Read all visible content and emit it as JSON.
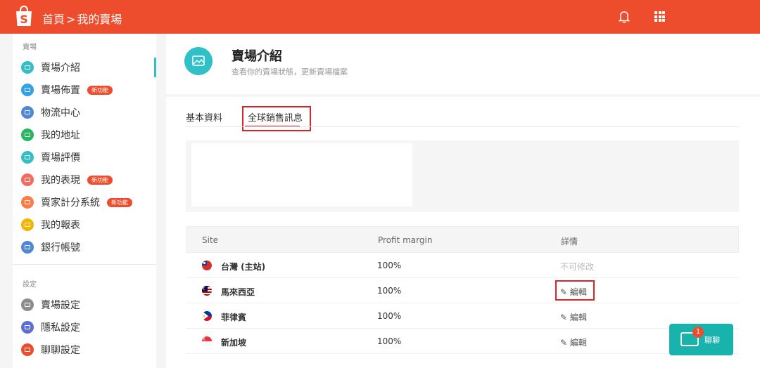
{
  "topbar": {
    "breadcrumb_home": "首頁",
    "breadcrumb_sep": ">",
    "breadcrumb_current": "我的賣場",
    "brand_color": "#ee4d2d"
  },
  "sidebar": {
    "section_shop": "賣場",
    "section_settings": "設定",
    "new_badge": "新功能",
    "shop_items": [
      {
        "label": "賣場介紹",
        "icon": "shop-intro-icon",
        "color": "#31c0c8"
      },
      {
        "label": "賣場佈置",
        "icon": "decoration-icon",
        "color": "#31a2e8"
      },
      {
        "label": "物流中心",
        "icon": "logistics-icon",
        "color": "#4f88d8"
      },
      {
        "label": "我的地址",
        "icon": "address-icon",
        "color": "#25b85f"
      },
      {
        "label": "賣場評價",
        "icon": "rating-icon",
        "color": "#31c0c8"
      },
      {
        "label": "我的表現",
        "icon": "performance-icon",
        "color": "#f56b5c"
      },
      {
        "label": "賣家計分系統",
        "icon": "score-icon",
        "color": "#ff7a45"
      },
      {
        "label": "我的報表",
        "icon": "report-icon",
        "color": "#f5b400"
      },
      {
        "label": "銀行帳號",
        "icon": "bank-icon",
        "color": "#4f88d8"
      }
    ],
    "settings_items": [
      {
        "label": "賣場設定",
        "icon": "shop-settings-icon",
        "color": "#8c8c8c"
      },
      {
        "label": "隱私設定",
        "icon": "privacy-icon",
        "color": "#5b6fd8"
      },
      {
        "label": "聊聊設定",
        "icon": "chat-settings-icon",
        "color": "#ee4d2d"
      }
    ]
  },
  "header": {
    "title": "賣場介紹",
    "subtitle": "查看你的賣場狀態，更新賣場檔案"
  },
  "tabs": {
    "basic": "基本資料",
    "global": "全球銷售訊息"
  },
  "table": {
    "headers": {
      "site": "Site",
      "profit": "Profit margin",
      "details": "詳情"
    },
    "rows": [
      {
        "site": "台灣 (主站)",
        "profit": "100%",
        "details": "不可修改"
      },
      {
        "site": "馬來西亞",
        "profit": "100%",
        "details": "✎ 編輯"
      },
      {
        "site": "菲律賓",
        "profit": "100%",
        "details": "✎ 編輯"
      },
      {
        "site": "新加坡",
        "profit": "100%",
        "details": "✎ 編輯"
      }
    ]
  },
  "chat": {
    "label": "聊聊",
    "badge": "1"
  }
}
